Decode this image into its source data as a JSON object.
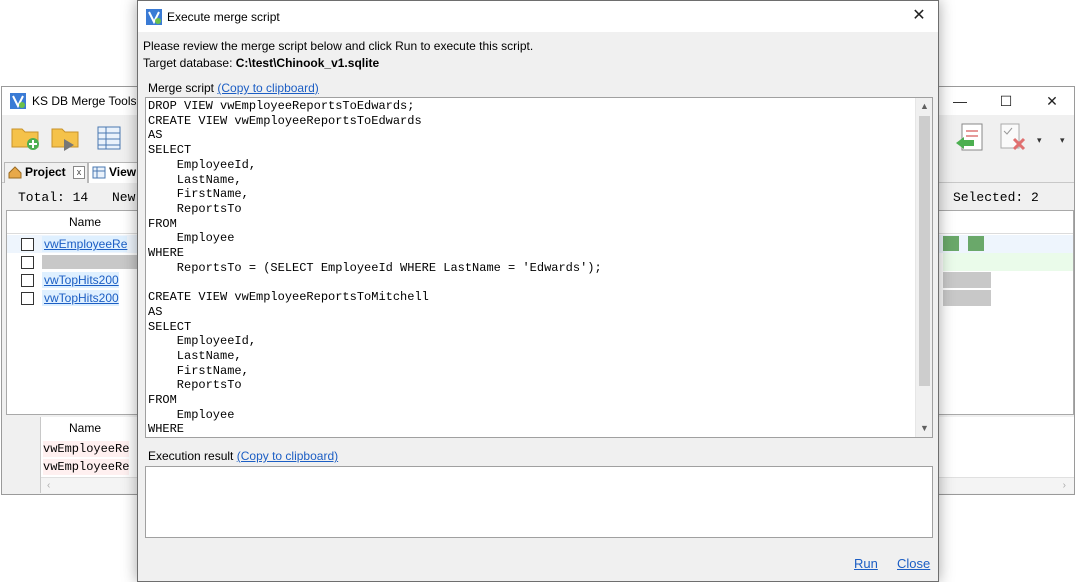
{
  "dialog": {
    "title": "Execute merge script",
    "close_glyph": "✕",
    "instruction": "Please review the merge script below and click Run to execute this script.",
    "target_label": "Target database:",
    "target_value": "C:\\test\\Chinook_v1.sqlite",
    "merge_script_label": "Merge script",
    "copy_script_link": "(Copy to clipboard)",
    "script_text": "DROP VIEW vwEmployeeReportsToEdwards;\nCREATE VIEW vwEmployeeReportsToEdwards\nAS\nSELECT\n    EmployeeId,\n    LastName,\n    FirstName,\n    ReportsTo\nFROM\n    Employee\nWHERE\n    ReportsTo = (SELECT EmployeeId WHERE LastName = 'Edwards');\n\nCREATE VIEW vwEmployeeReportsToMitchell\nAS\nSELECT\n    EmployeeId,\n    LastName,\n    FirstName,\n    ReportsTo\nFROM\n    Employee\nWHERE",
    "execution_result_label": "Execution result",
    "copy_result_link": "(Copy to clipboard)",
    "execution_result_text": "",
    "run_label": "Run",
    "close_label": "Close"
  },
  "background_app": {
    "title": "KS DB Merge Tools f",
    "minimize_glyph": "—",
    "maximize_glyph": "☐",
    "close_glyph": "✕",
    "tabs": [
      {
        "label": "Project",
        "close": "x"
      },
      {
        "label": "View"
      }
    ],
    "stats": {
      "total": "Total: 14",
      "new": "New",
      "selected": "Selected: 2"
    },
    "grid_top": {
      "column_name": "Name",
      "rows": [
        {
          "name": "vwEmployeeRe"
        },
        {
          "name": ""
        },
        {
          "name": "vwTopHits200"
        },
        {
          "name": "vwTopHits200"
        }
      ]
    },
    "grid_bottom": {
      "column_name": "Name",
      "rows": [
        {
          "name": "vwEmployeeRe"
        },
        {
          "name": "vwEmployeeRe"
        }
      ]
    },
    "colors": {
      "link": "#1c5ec4",
      "row_highlight": "#dff0ff",
      "diff_gray": "#c8c8c8"
    }
  }
}
